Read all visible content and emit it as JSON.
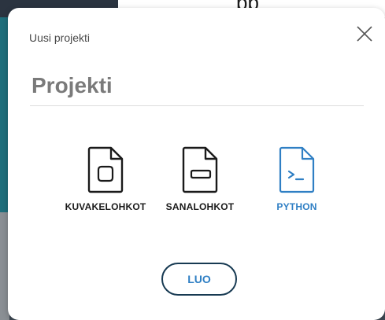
{
  "background": {
    "partial_text": "pp"
  },
  "dialog": {
    "subtitle": "Uusi projekti",
    "close_icon": "close-icon",
    "project_name_value": "Projekti",
    "project_types": [
      {
        "label": "KUVAKELOHKOT",
        "icon": "picture-blocks-file-icon",
        "selected": false
      },
      {
        "label": "SANALOHKOT",
        "icon": "word-blocks-file-icon",
        "selected": false
      },
      {
        "label": "PYTHON",
        "icon": "python-terminal-file-icon",
        "selected": true
      }
    ],
    "create_label": "LUO"
  },
  "colors": {
    "accent": "#2f7fc4",
    "button_border": "#173a52",
    "text_dark": "#1a1a1a",
    "title_gray": "#7a7a7a"
  }
}
